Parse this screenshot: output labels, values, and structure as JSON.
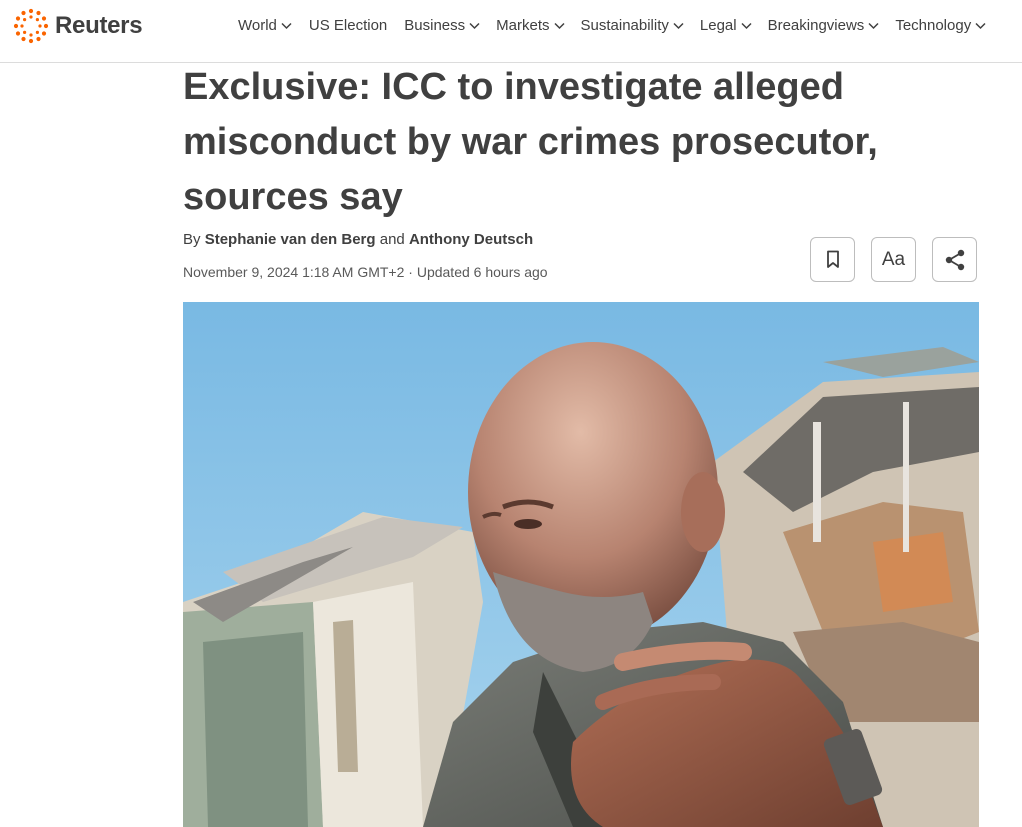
{
  "site": {
    "name": "Reuters"
  },
  "nav": [
    {
      "label": "World",
      "chevron": true
    },
    {
      "label": "US Election",
      "chevron": false
    },
    {
      "label": "Business",
      "chevron": true
    },
    {
      "label": "Markets",
      "chevron": true
    },
    {
      "label": "Sustainability",
      "chevron": true
    },
    {
      "label": "Legal",
      "chevron": true
    },
    {
      "label": "Breakingviews",
      "chevron": true
    },
    {
      "label": "Technology",
      "chevron": true
    }
  ],
  "article": {
    "headline": "Exclusive: ICC to investigate alleged misconduct by war crimes prosecutor, sources say",
    "byline_prefix": "By",
    "author1": "Stephanie van den Berg",
    "byline_and": "and",
    "author2": "Anthony Deutsch",
    "date": "November 9, 2024 1:18 AM GMT+2",
    "updated": "· Updated 6 hours ago"
  },
  "tools": {
    "bookmark_icon": "bookmark-icon",
    "text_size_label": "Aa",
    "share_icon": "share-icon"
  },
  "colors": {
    "brand": "#fa6400",
    "text": "#404040",
    "sky": "#8ec6e6"
  }
}
